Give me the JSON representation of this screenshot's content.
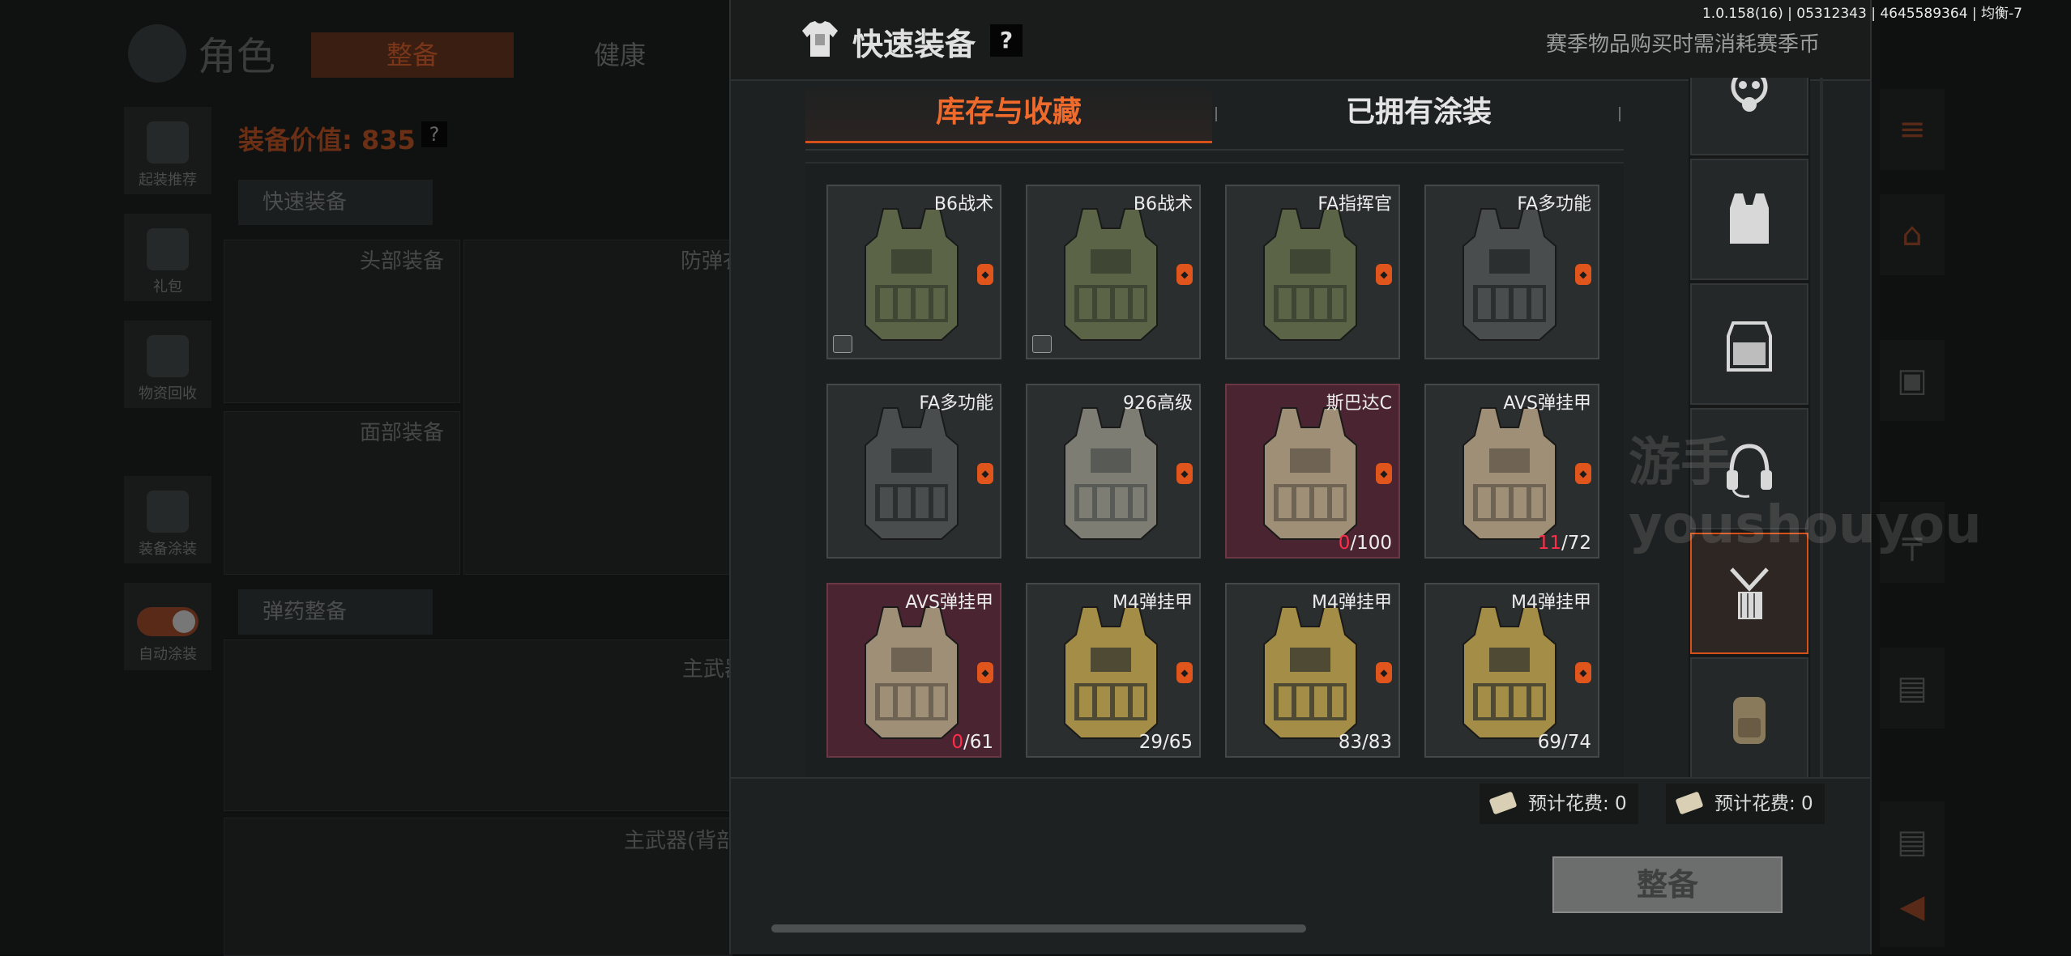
{
  "version_info": "1.0.158(16) | 05312343 | 4645589364 | 均衡-7",
  "background": {
    "title": "角色",
    "tabs": [
      "整备",
      "健康"
    ],
    "side_items": [
      "起装推荐",
      "礼包",
      "物资回收",
      "装备涂装",
      "自动涂装"
    ],
    "equip_value": "装备价值: 835",
    "help": "?",
    "quick_equip": "快速装备",
    "head_gear": "头部装备",
    "armor": "防弹衣",
    "face_gear": "面部装备",
    "ammo": "弹药整备",
    "primary": "主武器",
    "primary_back": "主武器(背部)"
  },
  "modal": {
    "title": "快速装备",
    "help": "?",
    "season_note": "赛季物品购买时需消耗赛季币",
    "tabs": [
      {
        "label": "库存与收藏",
        "active": true
      },
      {
        "label": "已拥有涂装",
        "active": false
      }
    ],
    "items": [
      {
        "name": "B6战术",
        "cur": "",
        "max": "",
        "red": false,
        "box": true,
        "color": "olive"
      },
      {
        "name": "B6战术",
        "cur": "",
        "max": "",
        "red": false,
        "box": true,
        "color": "olive"
      },
      {
        "name": "FA指挥官",
        "cur": "",
        "max": "",
        "red": false,
        "box": false,
        "color": "olive"
      },
      {
        "name": "FA多功能",
        "cur": "",
        "max": "",
        "red": false,
        "box": false,
        "color": "dark"
      },
      {
        "name": "FA多功能",
        "cur": "",
        "max": "",
        "red": false,
        "box": false,
        "color": "dark"
      },
      {
        "name": "926高级",
        "cur": "",
        "max": "",
        "red": false,
        "box": false,
        "color": "camo"
      },
      {
        "name": "斯巴达C",
        "cur": "0",
        "max": "/100",
        "red": true,
        "curRed": true,
        "box": false,
        "color": "tan"
      },
      {
        "name": "AVS弹挂甲",
        "cur": "11",
        "max": "/72",
        "red": false,
        "curRed": true,
        "box": false,
        "color": "tan"
      },
      {
        "name": "AVS弹挂甲",
        "cur": "0",
        "max": "/61",
        "red": true,
        "curRed": true,
        "box": false,
        "color": "tan"
      },
      {
        "name": "M4弹挂甲",
        "cur": "29",
        "max": "/65",
        "red": false,
        "curRed": false,
        "box": false,
        "color": "yellow"
      },
      {
        "name": "M4弹挂甲",
        "cur": "83",
        "max": "/83",
        "red": false,
        "curRed": false,
        "box": false,
        "color": "yellow"
      },
      {
        "name": "M4弹挂甲",
        "cur": "69",
        "max": "/74",
        "red": false,
        "curRed": false,
        "box": false,
        "color": "yellow"
      }
    ],
    "categories": [
      {
        "icon": "gas-mask-icon",
        "active": false
      },
      {
        "icon": "vest-icon",
        "active": false
      },
      {
        "icon": "plate-carrier-icon",
        "active": false
      },
      {
        "icon": "headset-icon",
        "active": false
      },
      {
        "icon": "chest-rig-icon",
        "active": true
      },
      {
        "icon": "backpack-icon",
        "active": false
      }
    ],
    "costs": [
      "预计花费: 0",
      "预计花费: 0"
    ],
    "equip_button": "整备",
    "watermark": "游手 youshouyou"
  },
  "colors": {
    "accent": "#d6501a",
    "accent_text": "#f06a2c",
    "red_value": "#ff2d4a"
  }
}
